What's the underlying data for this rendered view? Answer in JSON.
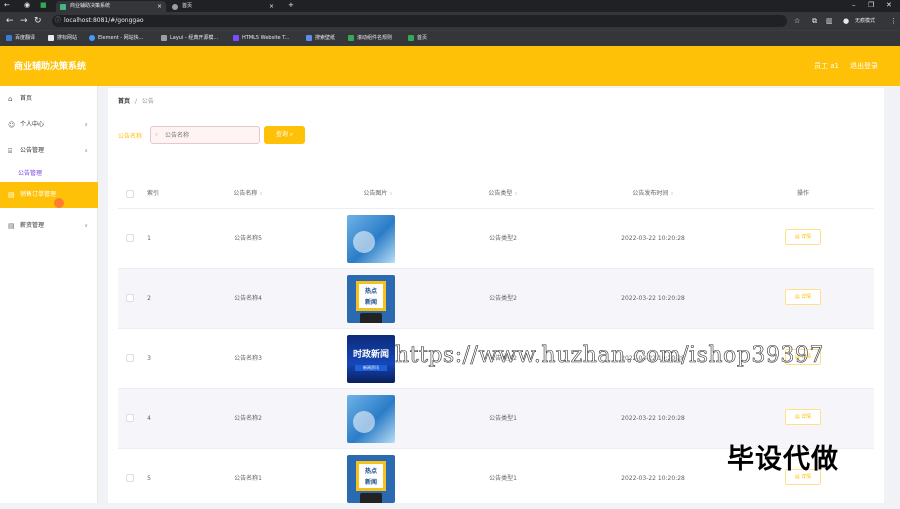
{
  "browser": {
    "tabs": [
      {
        "title": "商业辅助决策系统",
        "close": "×"
      },
      {
        "title": "首页",
        "close": "×"
      }
    ],
    "new_tab": "+",
    "url": "localhost:8081/#/gonggao",
    "profile_label": "无痕模式",
    "bookmarks": [
      "百度翻译",
      "搜标网站",
      "Element - 网站快...",
      "Layui - 经典开源模...",
      "HTML5 Website T...",
      "搜索壁纸",
      "滚动组件名规则",
      "首页"
    ]
  },
  "header": {
    "title": "商业辅助决策系统",
    "user": "员工 a1",
    "logout": "退出登录"
  },
  "sidebar": {
    "items": [
      {
        "label": "首页",
        "icon": "home-icon"
      },
      {
        "label": "个人中心",
        "icon": "user-icon"
      },
      {
        "label": "公告管理",
        "icon": "bank-icon"
      },
      {
        "label": "销售订单管理",
        "icon": "grid-icon"
      },
      {
        "label": "薪资管理",
        "icon": "grid-icon"
      }
    ],
    "submenu": {
      "label": "公告管理"
    }
  },
  "breadcrumb": {
    "home": "首页",
    "separator": "/",
    "current": "公告"
  },
  "search": {
    "label": "公告名称",
    "placeholder": "公告名称",
    "button": "查询"
  },
  "table": {
    "headers": {
      "index": "索引",
      "name": "公告名称",
      "image": "公告图片",
      "type": "公告类型",
      "time": "公告发布时间",
      "action": "操作"
    },
    "detail_label": "详情",
    "rows": [
      {
        "index": "1",
        "name": "公告名称5",
        "type": "公告类型2",
        "time": "2022-03-22 10:20:28",
        "image": "blue"
      },
      {
        "index": "2",
        "name": "公告名称4",
        "type": "公告类型2",
        "time": "2022-03-22 10:20:28",
        "image": "news"
      },
      {
        "index": "3",
        "name": "公告名称3",
        "type": "公告类型2",
        "time": "2022-03-22 10:20:28",
        "image": "politics"
      },
      {
        "index": "4",
        "name": "公告名称2",
        "type": "公告类型1",
        "time": "2022-03-22 10:20:28",
        "image": "blue"
      },
      {
        "index": "5",
        "name": "公告名称1",
        "type": "公告类型1",
        "time": "2022-03-22 10:20:28",
        "image": "news"
      }
    ]
  },
  "thumb_text": {
    "news_top": "热点",
    "news_bottom": "新闻",
    "politics_title": "时政新闻",
    "politics_sub": "新闻资讯"
  },
  "watermark": "https://www.huzhan.com/ishop39397",
  "badge": "毕设代做",
  "colors": {
    "accent": "#ffc107",
    "submenu": "#7b3fe4"
  }
}
